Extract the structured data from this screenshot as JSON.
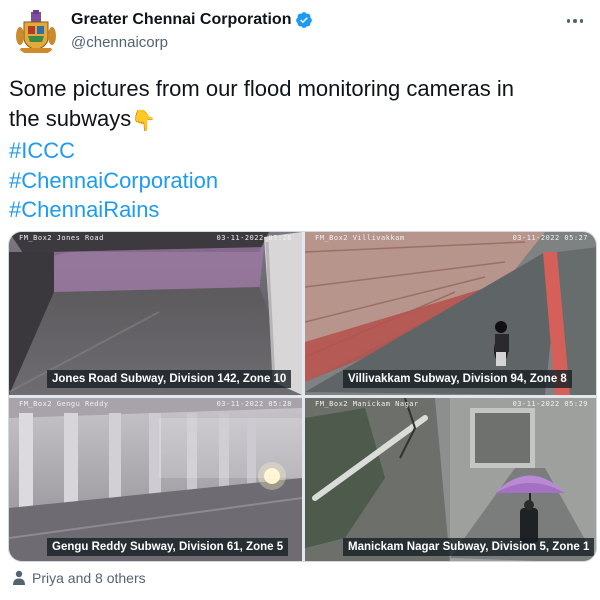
{
  "account": {
    "display_name": "Greater Chennai Corporation",
    "handle": "@chennaicorp",
    "verified": true
  },
  "tweet": {
    "text_lines": [
      "Some pictures from our flood monitoring cameras in",
      "the subways"
    ],
    "emoji": "👇",
    "hashtags": [
      "#ICCC",
      "#ChennaiCorporation",
      "#ChennaiRains"
    ]
  },
  "media": [
    {
      "caption": "Jones Road Subway, Division 142, Zone 10",
      "camera_label": "FM_Box2 Jones Road",
      "timestamp": "03-11-2022 05:26"
    },
    {
      "caption": "Villivakkam Subway, Division 94, Zone 8",
      "camera_label": "FM_Box2 Villivakkam",
      "timestamp": "03-11-2022 05:27"
    },
    {
      "caption": "Gengu Reddy Subway, Division 61, Zone 5",
      "camera_label": "FM_Box2 Gengu Reddy",
      "timestamp": "03-11-2022 05:28"
    },
    {
      "caption": "Manickam Nagar Subway, Division 5, Zone 1",
      "camera_label": "FM_Box2 Manickam Nagar",
      "timestamp": "03-11-2022 05:29"
    }
  ],
  "likes": {
    "text": "Priya and 8 others"
  },
  "colors": {
    "link": "#1d9bf0",
    "verified": "#1d9bf0",
    "secondary_text": "#536471"
  }
}
